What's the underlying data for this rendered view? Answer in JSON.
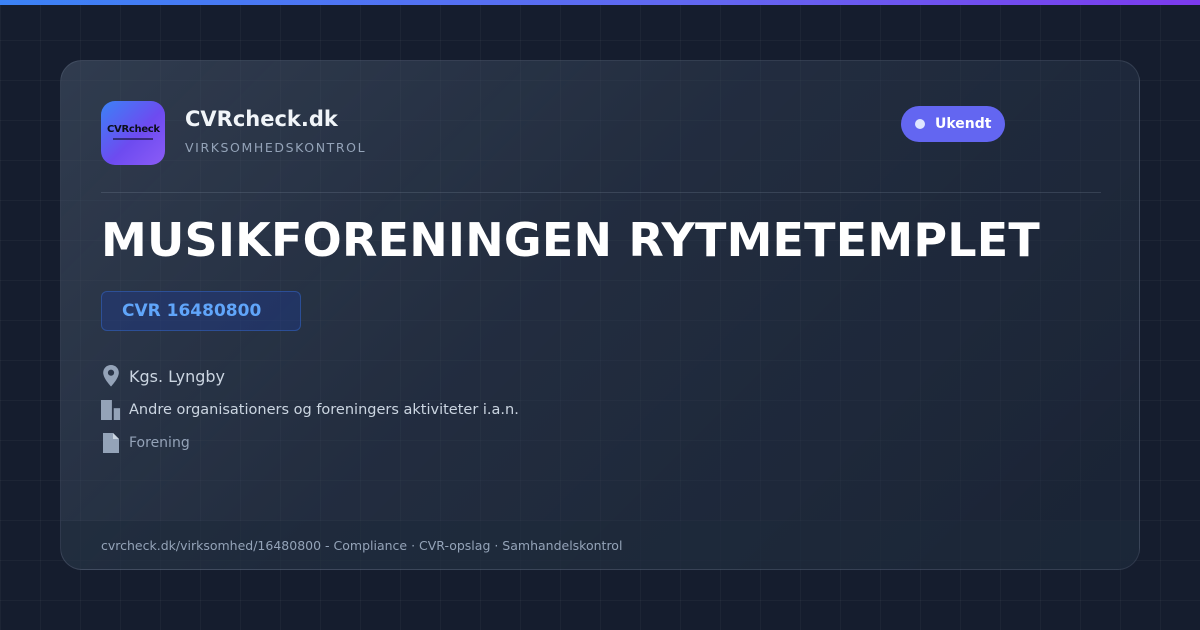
{
  "brand": {
    "name": "CVRcheck.dk",
    "tagline": "VIRKSOMHEDSKONTROL",
    "logo_text": "CVRcheck"
  },
  "status": {
    "label": "Ukendt"
  },
  "company": {
    "name": "MUSIKFORENINGEN RYTMETEMPLET",
    "cvr_label": "CVR 16480800",
    "location": "Kgs. Lyngby",
    "industry": "Andre organisationers og foreningers aktiviteter i.a.n.",
    "type": "Forening"
  },
  "footer": {
    "text": "cvrcheck.dk/virksomhed/16480800 - Compliance · CVR-opslag · Samhandelskontrol"
  },
  "icons": {
    "location": "map-pin-icon",
    "industry": "building-icon",
    "type": "document-icon"
  },
  "colors": {
    "background": "#151d2e",
    "accent": "#6366f1",
    "cvr_text": "#60a5fa",
    "top_bar_start": "#3b82f6",
    "top_bar_end": "#7c3aed"
  }
}
